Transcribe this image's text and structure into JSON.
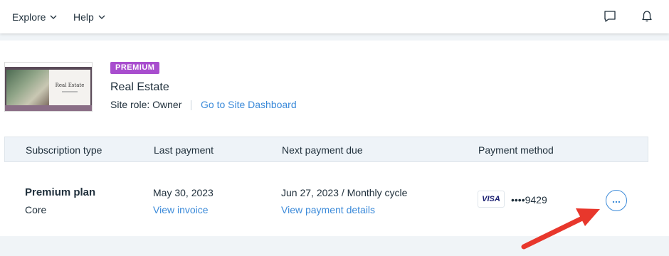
{
  "nav": {
    "items": [
      {
        "label": "Explore"
      },
      {
        "label": "Help"
      }
    ]
  },
  "site": {
    "badge": "PREMIUM",
    "name": "Real Estate",
    "role": "Site role: Owner",
    "dashboard_link": "Go to Site Dashboard",
    "thumbnail_title": "Real Estate"
  },
  "table": {
    "headers": [
      "Subscription type",
      "Last payment",
      "Next payment due",
      "Payment method"
    ],
    "row": {
      "plan_name": "Premium plan",
      "plan_type": "Core",
      "last_payment_date": "May 30, 2023",
      "view_invoice": "View invoice",
      "next_payment": "Jun 27, 2023 / Monthly cycle",
      "view_payment_details": "View payment details",
      "card_brand": "VISA",
      "card_number": "••••9429"
    }
  },
  "colors": {
    "accent": "#3b8ad9",
    "badge": "#a84dce",
    "annotation_arrow": "#e8372c"
  },
  "icons": {
    "chat": "chat-bubble-icon",
    "bell": "bell-icon",
    "more": "more-horizontal-icon"
  }
}
